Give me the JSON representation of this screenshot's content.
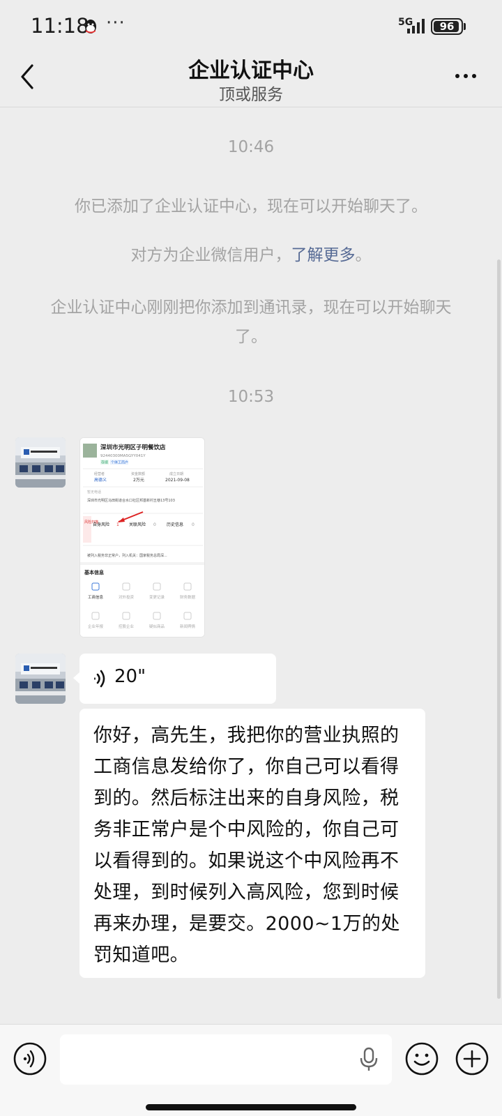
{
  "status_bar": {
    "time": "11:18",
    "more": "···",
    "network": "5G",
    "battery": "96",
    "battery_level": 0.96
  },
  "header": {
    "title": "企业认证中心",
    "subtitle": "顶或服务"
  },
  "messages": {
    "time1": "10:46",
    "sys1": "你已添加了企业认证中心，现在可以开始聊天了。",
    "sys2_prefix": "对方为企业微信用户，",
    "sys2_link": "了解更多",
    "sys2_suffix": "。",
    "sys3": "企业认证中心刚刚把你添加到通讯录，现在可以开始聊天了。",
    "time2": "10:53",
    "voice_duration": "20\"",
    "text": "你好，高先生，我把你的营业执照的工商信息发给你了，你自己可以看得到的。然后标注出来的自身风险，税务非正常户是个中风险的，你自己可以看得到的。如果说这个中风险再不处理，到时候列入高风险，您到时候再来办理，是要交。2000~1万的处罚知道吧。"
  },
  "image_card": {
    "company_name": "深圳市光明区子明餐饮店",
    "credit_code": "92440300MA5GYY041Y",
    "tag1": "存续",
    "tag2": "个体工商户",
    "legal_label": "经营者",
    "legal_value": "高德义",
    "capital_label": "资金数额",
    "capital_value": "2万元",
    "date_label": "成立日期",
    "date_value": "2021-09-08",
    "phone": "暂无电话",
    "address": "深圳市光明区马田街道合水口社区邦基新村五巷13号103",
    "risk_self": "自身风险",
    "risk_self_count": "1",
    "risk_related": "关联风险",
    "risk_related_count": "0",
    "risk_history": "历史信息",
    "risk_history_count": "0",
    "risk_side_label": "风险扫描",
    "notice": "被列入税务非正常户，列入机关：国家税务总局深...",
    "basic_info": "基本信息",
    "grid": [
      "工商信息",
      "对外投资",
      "变更记录",
      "财务数据",
      "企业年报",
      "控股企业",
      "疑似商品",
      "新闻舆情"
    ]
  },
  "colors": {
    "background": "#ededed",
    "bubble": "#ffffff",
    "system_text": "#a3a3a3",
    "link": "#576b95"
  }
}
